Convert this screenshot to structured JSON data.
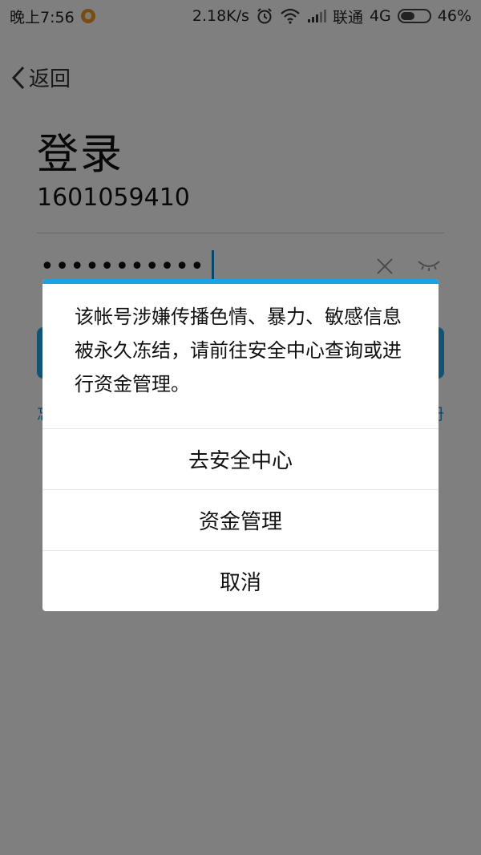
{
  "status_bar": {
    "time": "晚上7:56",
    "network_speed": "2.18K/s",
    "carrier": "联通",
    "network_type": "4G",
    "battery": "46%"
  },
  "nav": {
    "back_label": "返回"
  },
  "login": {
    "title": "登录",
    "account": "1601059410",
    "password_mask": "•••••••••••",
    "helper_left": "忘",
    "helper_right": "册"
  },
  "dialog": {
    "message": "该帐号涉嫌传播色情、暴力、敏感信息被永久冻结，请前往安全中心查询或进行资金管理。",
    "options": [
      {
        "label": "去安全中心"
      },
      {
        "label": "资金管理"
      },
      {
        "label": "取消"
      }
    ]
  },
  "colors": {
    "accent": "#1aa3e2",
    "login_button": "#27a4e6",
    "overlay": "rgba(0,0,0,0.5)"
  }
}
